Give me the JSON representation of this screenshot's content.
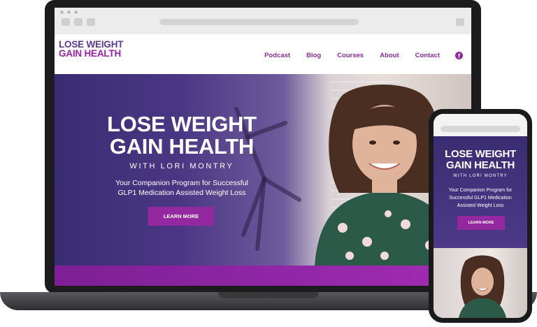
{
  "site": {
    "logo": {
      "line1": "LOSE WEIGHT",
      "line2": "GAIN HEALTH"
    },
    "nav": [
      {
        "label": "Podcast"
      },
      {
        "label": "Blog"
      },
      {
        "label": "Courses"
      },
      {
        "label": "About"
      },
      {
        "label": "Contact"
      }
    ],
    "social_icon": "facebook-icon",
    "social_glyph": "f"
  },
  "hero": {
    "title_line1": "LOSE WEIGHT",
    "title_line2": "GAIN HEALTH",
    "byline": "WITH LORI MONTRY",
    "subtitle_line1": "Your Companion Program for Successful",
    "subtitle_line2": "GLP1 Medication Assisted Weight Loss",
    "cta": "LEARN MORE"
  },
  "mobile": {
    "title_line1": "LOSE WEIGHT",
    "title_line2": "GAIN HEALTH",
    "byline": "WITH LORI MONTRY",
    "subtitle_line1": "Your Companion Program for",
    "subtitle_line2": "Successful GLP1 Medication",
    "subtitle_line3": "Assisted Weight Loss",
    "cta": "LEARN MORE"
  },
  "colors": {
    "brand_purple": "#5b3b8e",
    "accent_magenta": "#9428a1",
    "hero_dark": "#3a2c72"
  }
}
